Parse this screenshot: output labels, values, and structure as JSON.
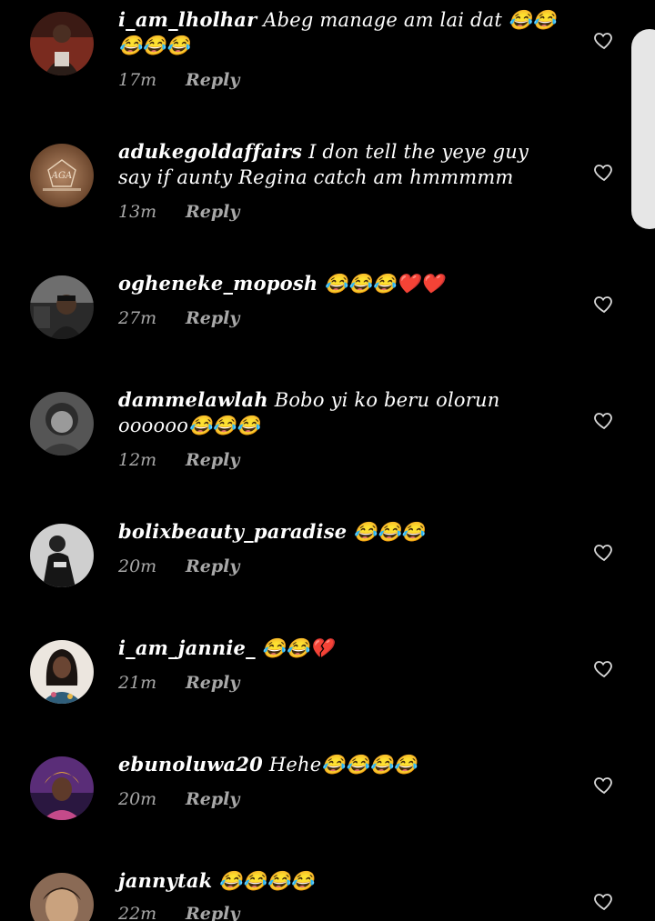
{
  "comments": [
    {
      "username": "i_am_lholhar",
      "text": "Abeg manage am lai dat 😂😂😂😂😂",
      "time": "17m",
      "reply": "Reply",
      "avatar_bg": "#7a2b1f"
    },
    {
      "username": "adukegoldaffairs",
      "text": "I don tell the yeye guy say if aunty Regina catch am hmmmmm",
      "time": "13m",
      "reply": "Reply",
      "avatar_bg": "#8b5e3c",
      "avatar_text": "AGA"
    },
    {
      "username": "ogheneke_moposh",
      "text": "😂😂😂❤️❤️",
      "time": "27m",
      "reply": "Reply",
      "avatar_bg": "#2a2a2a"
    },
    {
      "username": "dammelawlah",
      "text": "Bobo yi ko beru olorun oooooo😂😂😂",
      "time": "12m",
      "reply": "Reply",
      "avatar_bg": "#555555"
    },
    {
      "username": "bolixbeauty_paradise",
      "text": "😂😂😂",
      "time": "20m",
      "reply": "Reply",
      "avatar_bg": "#c8c8c8"
    },
    {
      "username": "i_am_jannie_",
      "text": "😂😂💔",
      "time": "21m",
      "reply": "Reply",
      "avatar_bg": "#e8e2dc"
    },
    {
      "username": "ebunoluwa20",
      "text": "Hehe😂😂😂😂",
      "time": "20m",
      "reply": "Reply",
      "avatar_bg": "#6b3a8a"
    },
    {
      "username": "jannytak",
      "text": "😂😂😂😂",
      "time": "22m",
      "reply": "Reply",
      "avatar_bg": "#8a6a55"
    }
  ]
}
